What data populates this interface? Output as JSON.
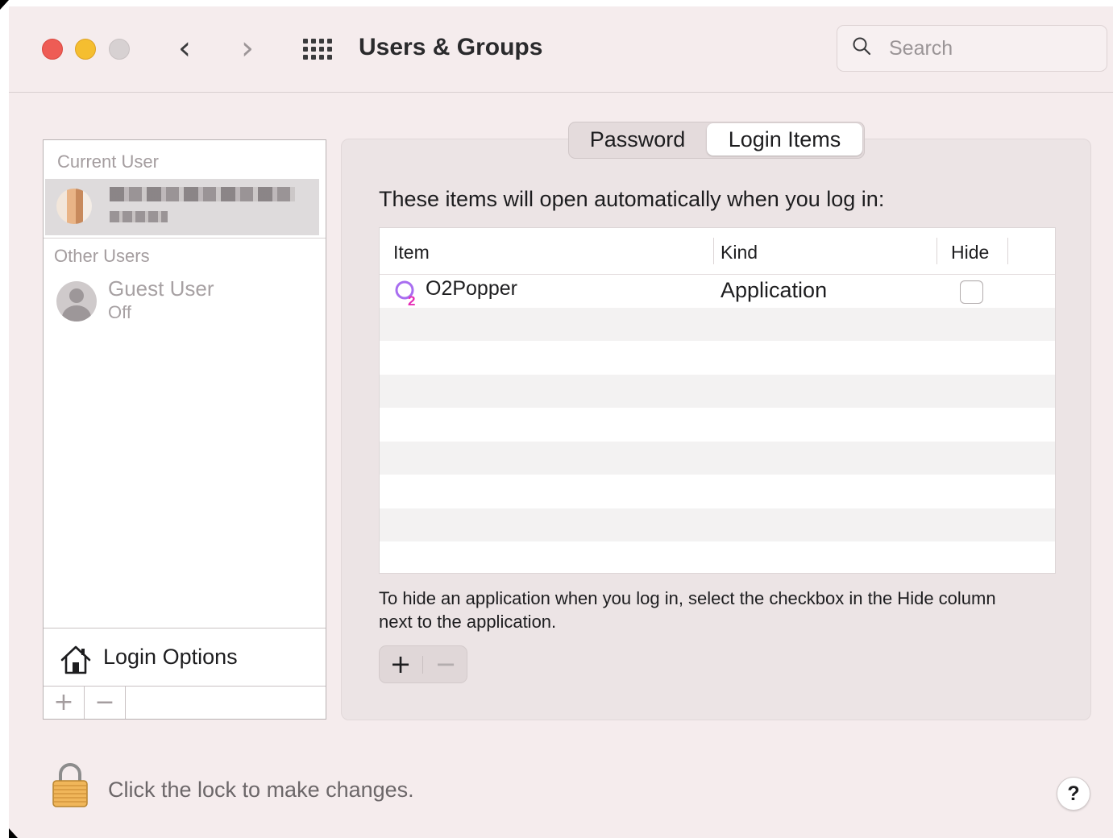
{
  "window": {
    "title": "Users & Groups",
    "traffic_lights": {
      "close": "#ee5c55",
      "minimize": "#f5be30",
      "zoom": "#d7d1d2"
    }
  },
  "toolbar": {
    "back_glyph": "‹",
    "forward_glyph": "›",
    "show_all_icon": "grid-icon"
  },
  "search": {
    "placeholder": "Search",
    "value": ""
  },
  "sidebar": {
    "current_user_header": "Current User",
    "other_users_header": "Other Users",
    "guest": {
      "name": "Guest User",
      "status": "Off"
    },
    "login_options_label": "Login Options",
    "add_label": "+",
    "remove_label": "−"
  },
  "tabs": {
    "password": "Password",
    "login_items": "Login Items",
    "selected": "Login Items"
  },
  "login_items": {
    "intro": "These items will open automatically when you log in:",
    "columns": {
      "item": "Item",
      "kind": "Kind",
      "hide": "Hide"
    },
    "rows": [
      {
        "item": "O2Popper",
        "kind": "Application",
        "hide": false
      }
    ],
    "hint": "To hide an application when you log in, select the checkbox in the Hide column next to the application.",
    "add_label": "+",
    "remove_label": "−"
  },
  "footer": {
    "lock_text": "Click the lock to make changes.",
    "help_label": "?"
  }
}
